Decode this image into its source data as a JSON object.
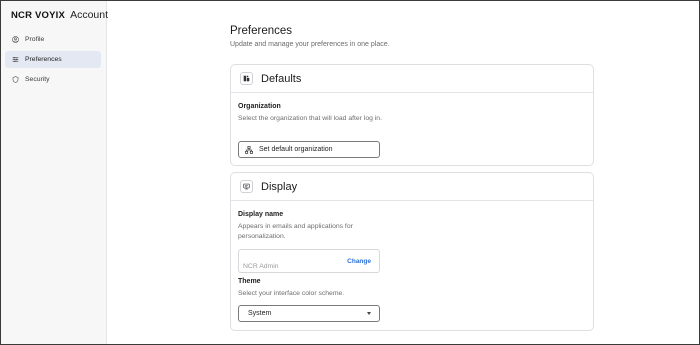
{
  "brand": {
    "logo": "NCR VOYIX",
    "app_name": "Account"
  },
  "sidebar": {
    "items": [
      {
        "label": "Profile",
        "icon": "user-circle-icon",
        "active": false
      },
      {
        "label": "Preferences",
        "icon": "sliders-icon",
        "active": true
      },
      {
        "label": "Security",
        "icon": "shield-icon",
        "active": false
      }
    ]
  },
  "main": {
    "title": "Preferences",
    "subtitle": "Update and manage your preferences in one place."
  },
  "defaults_card": {
    "title": "Defaults",
    "icon": "defaults-icon",
    "organization_label": "Organization",
    "organization_help": "Select the organization that will load after log in.",
    "set_default_button": "Set default organization",
    "button_icon": "hierarchy-icon"
  },
  "display_card": {
    "title": "Display",
    "icon": "monitor-icon",
    "display_name_label": "Display name",
    "display_name_help": "Appears in emails and applications for personalization.",
    "display_name_value": "NCR Admin",
    "change_link": "Change",
    "theme_label": "Theme",
    "theme_help": "Select your interface color scheme.",
    "theme_value": "System"
  },
  "colors": {
    "accent_link": "#2a6fd6",
    "active_nav_bg": "#e3e8f3",
    "sidebar_bg": "#f7f7f8"
  }
}
